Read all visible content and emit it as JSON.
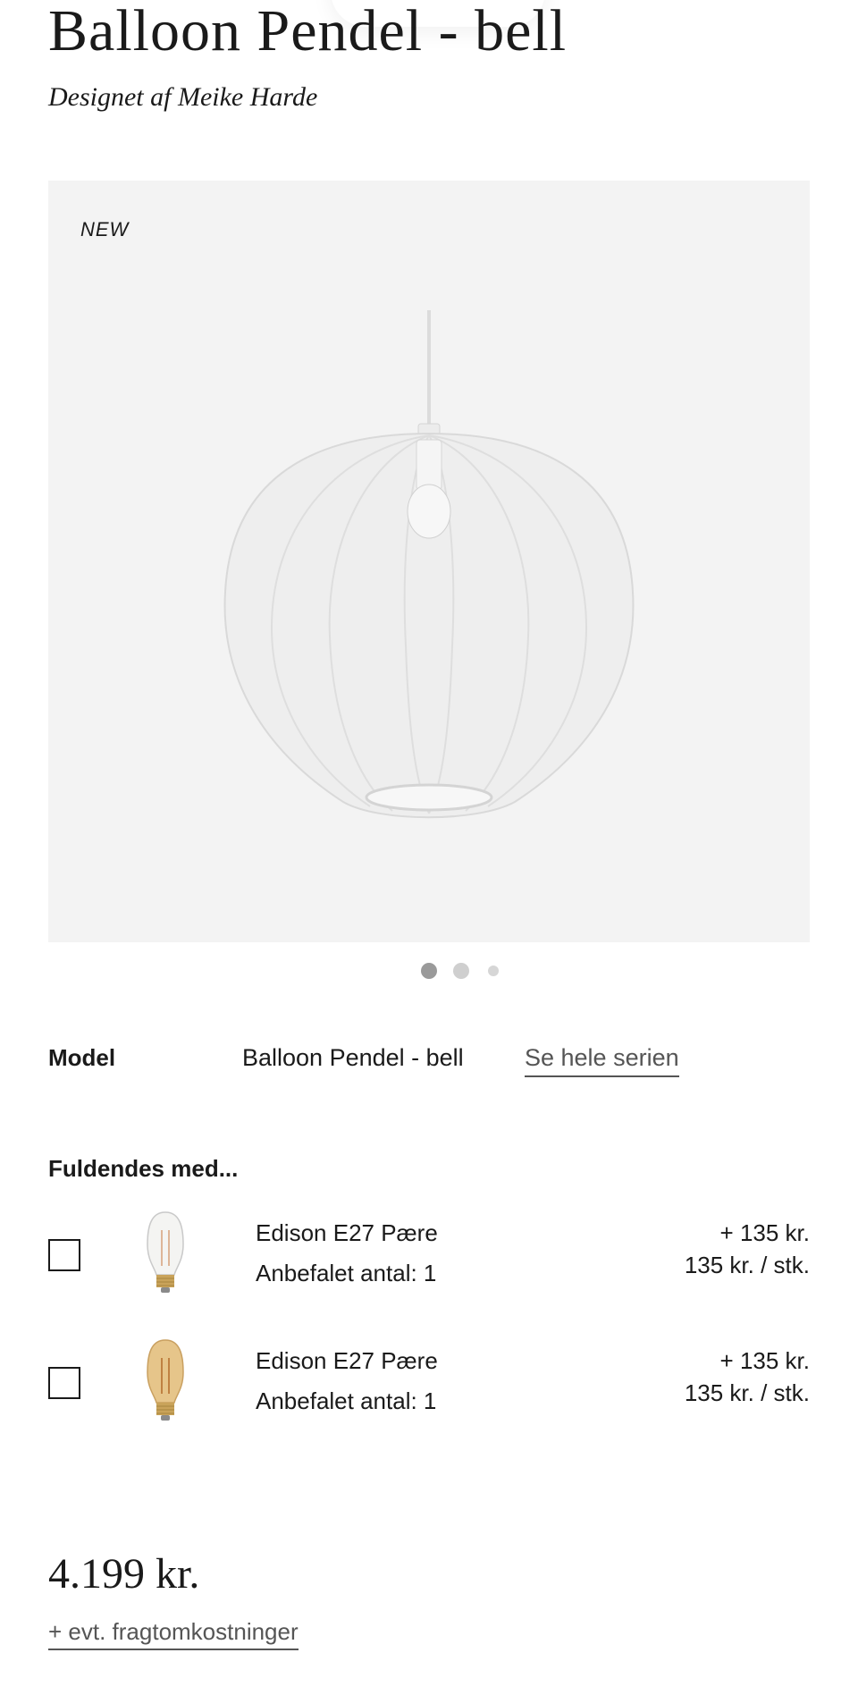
{
  "product": {
    "title": "Balloon Pendel - bell",
    "designer": "Designet af Meike Harde"
  },
  "gallery": {
    "badge": "NEW",
    "image_icon": "pendant-lamp-icon",
    "active_slide": 1,
    "slide_count": 3
  },
  "model": {
    "label": "Model",
    "value": "Balloon Pendel - bell",
    "series_link": "Se hele serien"
  },
  "addons": {
    "heading": "Fuldendes med...",
    "items": [
      {
        "name": "Edison E27 Pære",
        "qty": "Anbefalet antal: 1",
        "price": "+ 135 kr.",
        "unit": "135 kr. / stk.",
        "icon": "clear-bulb-icon",
        "checked": false
      },
      {
        "name": "Edison E27 Pære",
        "qty": "Anbefalet antal: 1",
        "price": "+ 135 kr.",
        "unit": "135 kr. / stk.",
        "icon": "amber-bulb-icon",
        "checked": false
      }
    ]
  },
  "pricing": {
    "total": "4.199 kr.",
    "shipping_link": "+ evt. fragtomkostninger"
  },
  "colors": {
    "text": "#1a1a1a",
    "link": "#555555",
    "gallery_bg": "#f3f3f3",
    "dot_active": "#9a9a9a",
    "dot_inactive": "#cfcfcf"
  }
}
